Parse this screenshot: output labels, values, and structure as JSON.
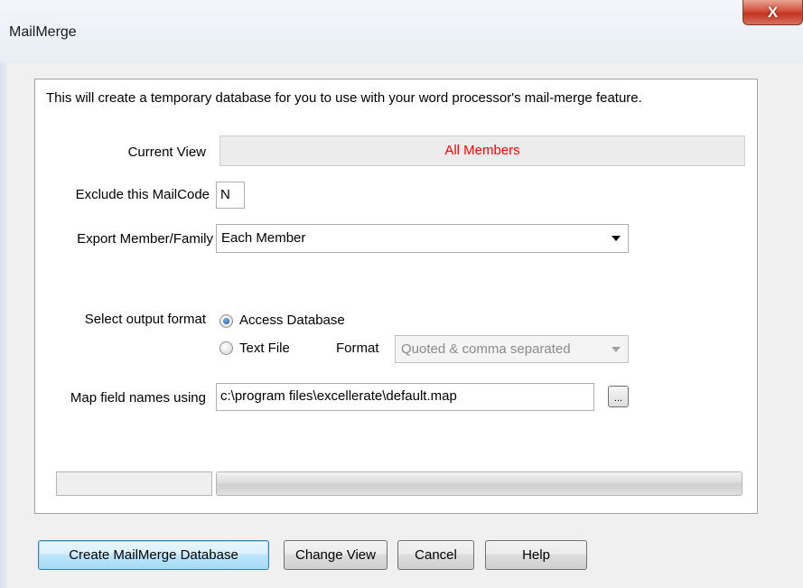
{
  "window": {
    "title": "MailMerge",
    "close_label": "X"
  },
  "intro_text": "This will create a temporary database for you to use with your word processor's mail-merge feature.",
  "current_view": {
    "label": "Current View",
    "value": "All Members"
  },
  "exclude": {
    "label": "Exclude this MailCode",
    "value": "N"
  },
  "export": {
    "label": "Export Member/Family",
    "value": "Each Member"
  },
  "output_format": {
    "label": "Select output format",
    "options": [
      "Access Database",
      "Text File"
    ],
    "selected": "Access Database",
    "format_label": "Format",
    "format_value": "Quoted & comma separated"
  },
  "map_fields": {
    "label": "Map field names using",
    "value": "c:\\program files\\excellerate\\default.map",
    "browse_label": "..."
  },
  "progress": {
    "percent": 100
  },
  "buttons": {
    "create": "Create MailMerge Database",
    "change_view": "Change View",
    "cancel": "Cancel",
    "help": "Help"
  },
  "colors": {
    "current_view_text": "#ff0000",
    "default_button": "#3c7fb1"
  }
}
